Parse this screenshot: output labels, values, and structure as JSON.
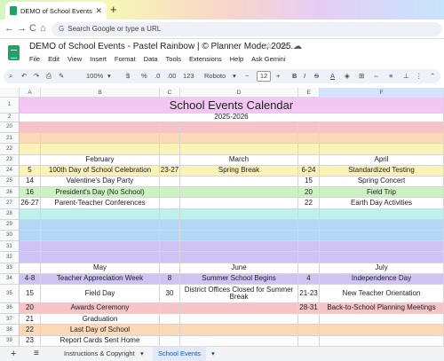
{
  "browser": {
    "tab_title": "DEMO of School Events - Pastel",
    "new_tab_symbol": "+",
    "back_symbol": "←",
    "forward_symbol": "→",
    "reload_symbol": "C",
    "home_symbol": "⌂",
    "address_placeholder": "Search Google or type a URL"
  },
  "doc": {
    "title": "DEMO of School Events - Pastel Rainbow | © Planner Mode, 2025.",
    "menus": [
      "File",
      "Edit",
      "View",
      "Insert",
      "Format",
      "Data",
      "Tools",
      "Extensions",
      "Help",
      "Ask Gemini"
    ]
  },
  "toolbar": {
    "zoom": "100%",
    "currency": "$",
    "percent": "%",
    "number_format": "123",
    "font": "Roboto",
    "font_size": "12"
  },
  "sheet": {
    "columns": [
      "A",
      "B",
      "C",
      "D",
      "E",
      "F"
    ],
    "selected_column": "F",
    "title": "School Events Calendar",
    "subtitle": "2025-2026",
    "rows": [
      {
        "num": "1",
        "kind": "title"
      },
      {
        "num": "2",
        "kind": "subtitle"
      },
      {
        "num": "20",
        "cells": [
          "",
          "",
          "",
          "",
          "",
          ""
        ]
      },
      {
        "num": "21",
        "cells": [
          "",
          "",
          "",
          "",
          "",
          ""
        ]
      },
      {
        "num": "22",
        "cells": [
          "",
          "",
          "",
          "",
          "",
          ""
        ]
      },
      {
        "num": "23",
        "cells": [
          "",
          "February",
          "",
          "March",
          "",
          "April"
        ]
      },
      {
        "num": "24",
        "cells": [
          "5",
          "100th Day of School Celebration",
          "23-27",
          "Spring Break",
          "6-24",
          "Standardized Testing"
        ]
      },
      {
        "num": "25",
        "cells": [
          "14",
          "Valentine's Day Party",
          "",
          "",
          "15",
          "Spring Concert"
        ]
      },
      {
        "num": "26",
        "cells": [
          "16",
          "President's Day (No School)",
          "",
          "",
          "20",
          "Field Trip"
        ]
      },
      {
        "num": "27",
        "cells": [
          "26-27",
          "Parent-Teacher Conferences",
          "",
          "",
          "22",
          "Earth Day Activities"
        ]
      },
      {
        "num": "28",
        "cells": [
          "",
          "",
          "",
          "",
          "",
          ""
        ]
      },
      {
        "num": "29",
        "cells": [
          "",
          "",
          "",
          "",
          "",
          ""
        ]
      },
      {
        "num": "30",
        "cells": [
          "",
          "",
          "",
          "",
          "",
          ""
        ]
      },
      {
        "num": "31",
        "cells": [
          "",
          "",
          "",
          "",
          "",
          ""
        ]
      },
      {
        "num": "32",
        "cells": [
          "",
          "",
          "",
          "",
          "",
          ""
        ]
      },
      {
        "num": "33",
        "cells": [
          "",
          "May",
          "",
          "June",
          "",
          "July"
        ]
      },
      {
        "num": "34",
        "cells": [
          "4-8",
          "Teacher Appreciation Week",
          "8",
          "Summer School Begins",
          "4",
          "Independence Day"
        ]
      },
      {
        "num": "35",
        "cells": [
          "15",
          "Field Day",
          "30",
          "District Offices Closed for Summer Break",
          "21-23",
          "New Teacher Orientation"
        ]
      },
      {
        "num": "36",
        "cells": [
          "20",
          "Awards Ceremony",
          "",
          "",
          "28-31",
          "Back-to-School Planning Meetings"
        ]
      },
      {
        "num": "37",
        "cells": [
          "21",
          "Graduation",
          "",
          "",
          "",
          ""
        ]
      },
      {
        "num": "38",
        "cells": [
          "22",
          "Last Day of School",
          "",
          "",
          "",
          ""
        ]
      },
      {
        "num": "39",
        "cells": [
          "23",
          "Report Cards Sent Home",
          "",
          "",
          "",
          ""
        ]
      }
    ]
  },
  "sheet_tabs": {
    "add_symbol": "+",
    "list_symbol": "≡",
    "tabs": [
      "Instructions & Copyright",
      "School Events"
    ],
    "active": "School Events"
  },
  "colors": {
    "title_bg": "#f2c7f1",
    "pink": "#f6c3c6",
    "orange": "#fbd9b6",
    "yellow": "#fbf3b6",
    "green": "#cdf2c2",
    "teal": "#bff0ec",
    "blue": "#b4d7f5",
    "purple": "#cfc3f5"
  }
}
